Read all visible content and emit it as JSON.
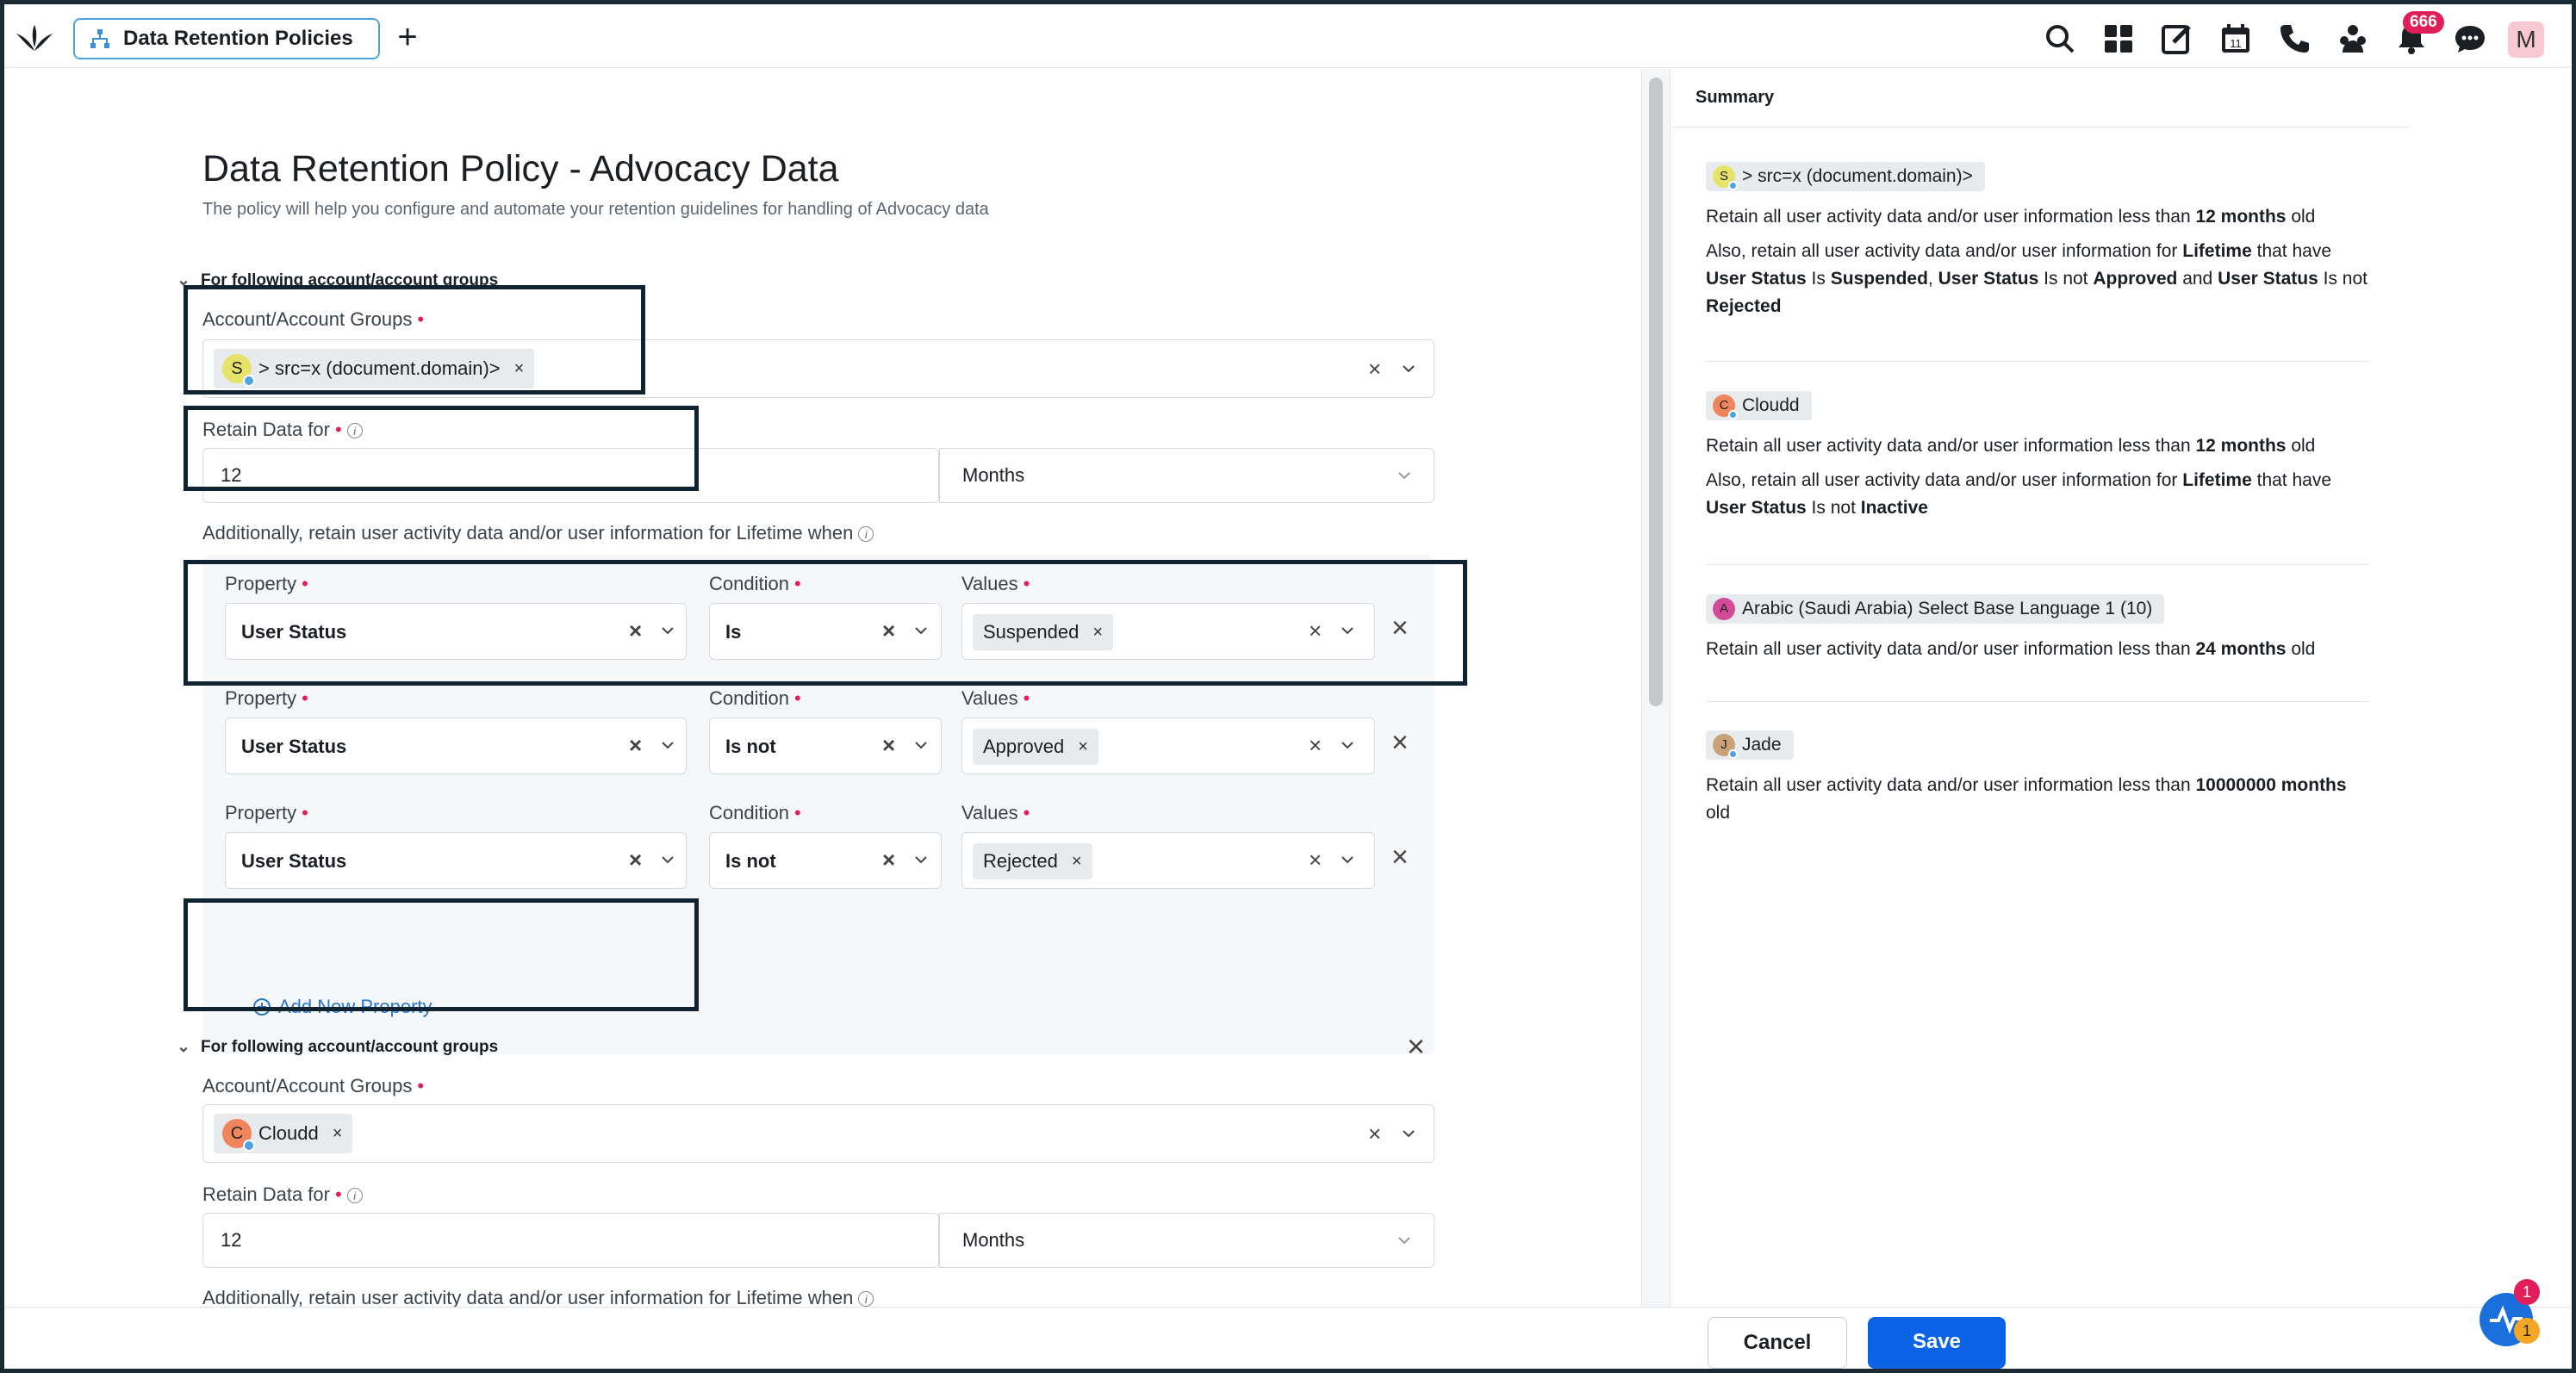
{
  "topbar": {
    "tab_title": "Data Retention Policies",
    "notification_count": "666",
    "user_initial": "M",
    "icons": [
      "search-icon",
      "apps-grid-icon",
      "compose-icon",
      "calendar-icon",
      "phone-icon",
      "community-icon",
      "bell-icon",
      "chat-icon"
    ],
    "calendar_day": "11"
  },
  "page": {
    "title": "Data Retention Policy - Advocacy Data",
    "subtitle": "The policy will help you configure and automate your retention guidelines for handling of Advocacy data"
  },
  "labels": {
    "section": "For following account/account groups",
    "account_groups": "Account/Account Groups",
    "retain_for": "Retain Data for",
    "additionally": "Additionally, retain user activity data and/or user information for Lifetime when",
    "property": "Property",
    "condition": "Condition",
    "values": "Values",
    "add_property": "Add New Property"
  },
  "group1": {
    "account": {
      "initial": "S",
      "name": "> src=x (document.domain)>",
      "color": "#e6e36a"
    },
    "retain_value": "12",
    "retain_unit": "Months",
    "rules": [
      {
        "property": "User Status",
        "condition": "Is",
        "value": "Suspended"
      },
      {
        "property": "User Status",
        "condition": "Is not",
        "value": "Approved"
      },
      {
        "property": "User Status",
        "condition": "Is not",
        "value": "Rejected"
      }
    ]
  },
  "group2": {
    "account": {
      "initial": "C",
      "name": "Cloudd",
      "color": "#f0845a"
    },
    "retain_value": "12",
    "retain_unit": "Months"
  },
  "summary": {
    "title": "Summary",
    "cards": [
      {
        "initial": "S",
        "tag": "> src=x (document.domain)>",
        "color": "#e6e36a",
        "line1": [
          "Retain all user activity data and/or user information less than ",
          "12 months",
          " old"
        ],
        "line2": [
          "Also, retain all user activity data and/or user information for ",
          "Lifetime",
          " that have ",
          "User Status",
          " Is ",
          "Suspended",
          ", ",
          "User Status",
          " Is not ",
          "Approved",
          " and ",
          "User Status",
          " Is not ",
          "Rejected"
        ]
      },
      {
        "initial": "C",
        "tag": "Cloudd",
        "color": "#f0845a",
        "line1": [
          "Retain all user activity data and/or user information less than ",
          "12 months",
          " old"
        ],
        "line2": [
          "Also, retain all user activity data and/or user information for ",
          "Lifetime",
          " that have ",
          "User Status",
          " Is not ",
          "Inactive"
        ]
      },
      {
        "initial": "A",
        "tag": "Arabic (Saudi Arabia) Select Base Language 1 (10)",
        "color": "#d44a9a",
        "line1": [
          "Retain all user activity data and/or user information less than ",
          "24 months",
          " old"
        ]
      },
      {
        "initial": "J",
        "tag": "Jade",
        "color": "#c9a27a",
        "line1": [
          "Retain all user activity data and/or user information less than ",
          "10000000 months",
          " old"
        ]
      }
    ]
  },
  "footer": {
    "cancel": "Cancel",
    "save": "Save"
  },
  "fab": {
    "badge_top": "1",
    "badge_bottom": "1"
  },
  "colors": {
    "primary": "#0b63e5",
    "link": "#2877d1",
    "required": "#e01e5a",
    "highlight": "#0f2430"
  }
}
